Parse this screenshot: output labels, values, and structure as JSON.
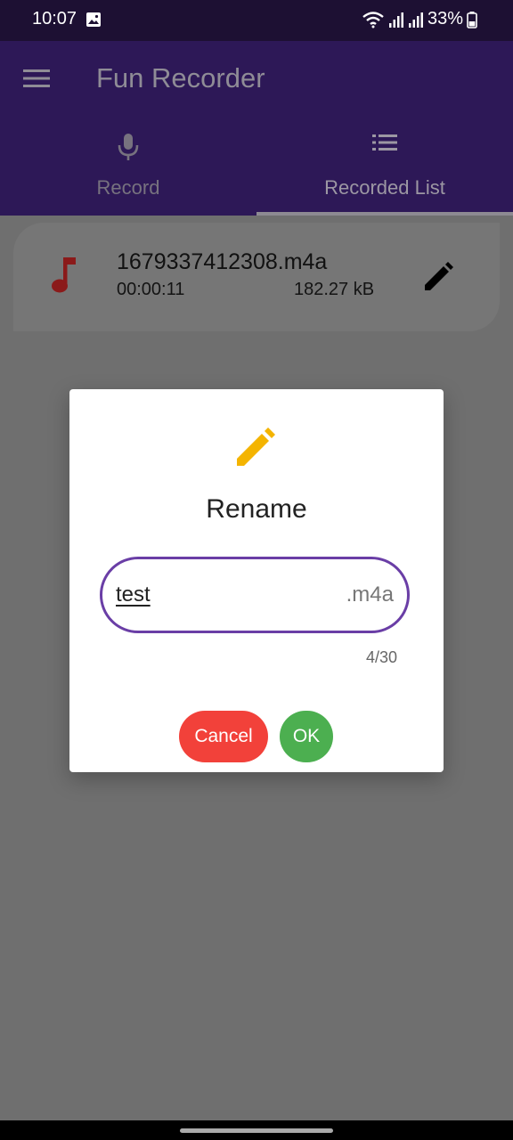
{
  "status": {
    "time": "10:07",
    "battery": "33%",
    "icons": [
      "photo-icon",
      "wifi-icon",
      "signal-icon",
      "signal-icon",
      "battery-icon"
    ]
  },
  "app": {
    "title": "Fun Recorder",
    "menu_icon": "menu-icon"
  },
  "tabs": [
    {
      "label": "Record",
      "icon": "microphone-icon",
      "selected": false
    },
    {
      "label": "Recorded List",
      "icon": "list-icon",
      "selected": true
    }
  ],
  "recordings": [
    {
      "name": "1679337412308.m4a",
      "duration": "00:00:11",
      "size": "182.27 kB"
    }
  ],
  "dialog": {
    "title": "Rename",
    "input_value": "test",
    "suffix": ".m4a",
    "counter": "4/30",
    "cancel_label": "Cancel",
    "ok_label": "OK"
  },
  "colors": {
    "app_bar": "#2d1857",
    "field_border": "#6a3ea6",
    "cancel": "#f2413a",
    "ok": "#4caf50",
    "pencil": "#f4b400",
    "note": "#8b1a1a"
  }
}
